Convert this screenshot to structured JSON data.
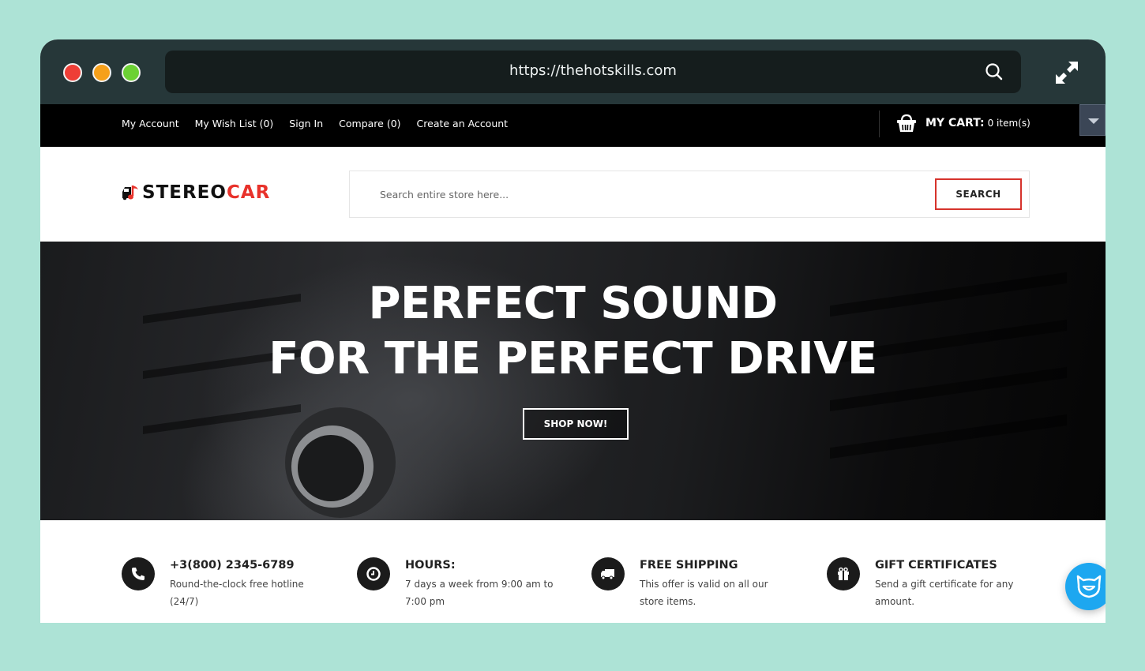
{
  "browser": {
    "url": "https://thehotskills.com",
    "window_controls": [
      "close",
      "minimize",
      "maximize"
    ],
    "icons": {
      "url_search": "search-icon",
      "expand": "expand-icon"
    }
  },
  "topnav": {
    "links": [
      {
        "label": "My Account"
      },
      {
        "label": "My Wish List (0)"
      },
      {
        "label": "Sign In"
      },
      {
        "label": "Compare (0)"
      },
      {
        "label": "Create an Account"
      }
    ],
    "cart": {
      "label": "MY CART:",
      "count": "0 item(s)",
      "icon": "basket-icon"
    }
  },
  "header": {
    "logo": {
      "part1": "STEREO",
      "part2": "CAR",
      "icon": "car-music-note-icon"
    },
    "search": {
      "placeholder": "Search entire store here...",
      "value": "",
      "button_label": "SEARCH"
    }
  },
  "hero": {
    "title_line1": "PERFECT SOUND",
    "title_line2": "FOR THE PERFECT DRIVE",
    "button_label": "SHOP NOW!"
  },
  "features": [
    {
      "icon": "phone-icon",
      "title": "+3(800) 2345-6789",
      "description": "Round-the-clock free hotline (24/7)"
    },
    {
      "icon": "clock-icon",
      "title": "HOURS:",
      "description": "7 days a week from 9:00 am to 7:00 pm"
    },
    {
      "icon": "truck-icon",
      "title": "FREE SHIPPING",
      "description": "This offer is valid on all our store items."
    },
    {
      "icon": "gift-icon",
      "title": "GIFT CERTIFICATES",
      "description": "Send a gift certificate for any amount."
    }
  ],
  "colors": {
    "page_background": "#ade3d6",
    "chrome": "#263739",
    "urlbar": "#151d1d",
    "accent_red": "#e8322b",
    "chat_blue": "#1da7f0"
  }
}
